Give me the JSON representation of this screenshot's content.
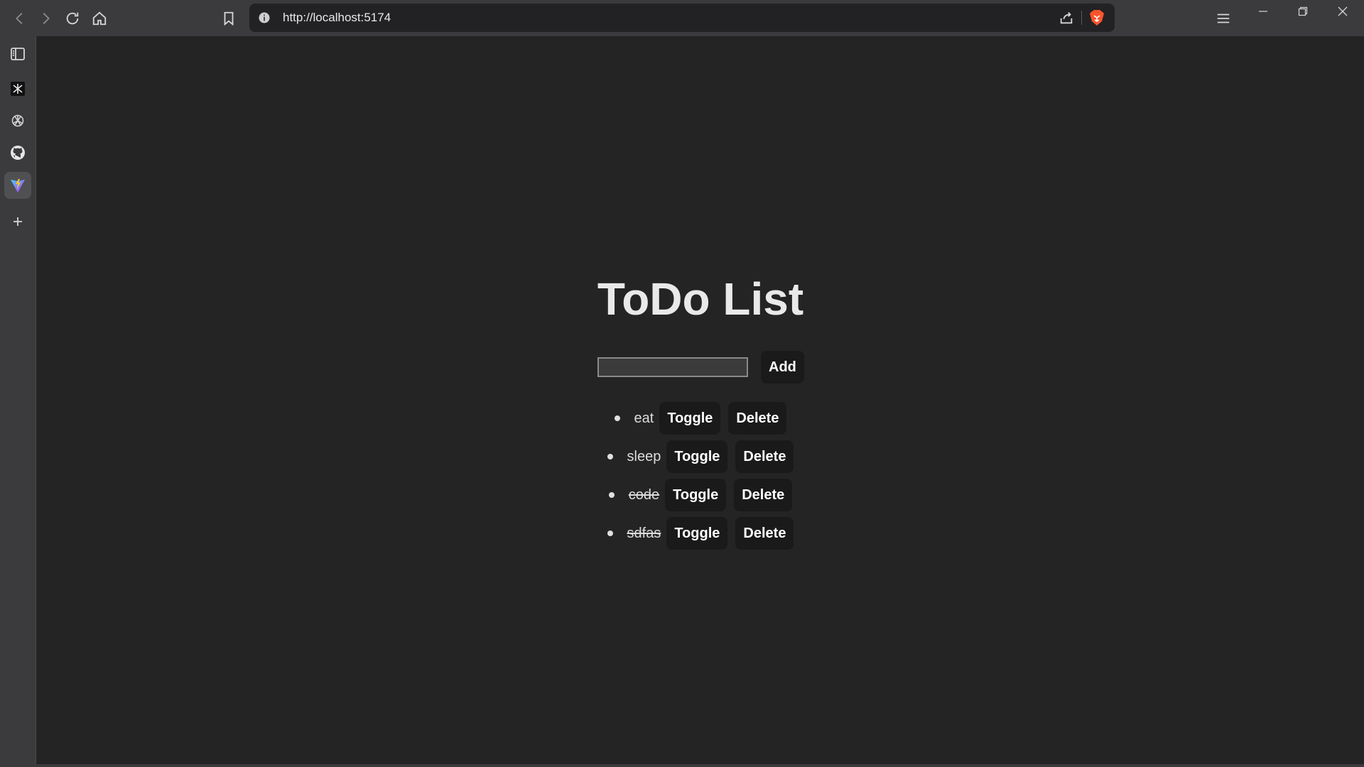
{
  "browser": {
    "url": "http://localhost:5174",
    "brand_color": "#fb542b",
    "icons": {
      "back": "chevron-left-icon",
      "forward": "chevron-right-icon",
      "reload": "reload-icon",
      "home": "home-icon",
      "bookmark": "bookmark-icon",
      "info": "info-icon",
      "share": "share-icon",
      "shields": "brave-lion-icon",
      "menu": "hamburger-menu-icon",
      "minimize": "minimize-icon",
      "restore": "restore-icon",
      "close": "close-icon"
    }
  },
  "sidebar": {
    "items": [
      {
        "name": "sidebar-panel-toggle",
        "icon": "sidebar-panel-icon"
      },
      {
        "name": "sidebar-app-1",
        "icon": "app-logo-icon"
      },
      {
        "name": "sidebar-app-openai",
        "icon": "openai-icon"
      },
      {
        "name": "sidebar-app-github",
        "icon": "github-icon"
      },
      {
        "name": "sidebar-app-vite",
        "icon": "vite-icon",
        "active": true
      },
      {
        "name": "sidebar-add",
        "icon": "plus-icon"
      }
    ]
  },
  "app": {
    "title": "ToDo List",
    "input_value": "",
    "add_label": "Add",
    "todos": [
      {
        "text": "eat",
        "done": false
      },
      {
        "text": "sleep",
        "done": false
      },
      {
        "text": "code",
        "done": true
      },
      {
        "text": "sdfas",
        "done": true
      }
    ],
    "toggle_label": "Toggle",
    "delete_label": "Delete"
  }
}
